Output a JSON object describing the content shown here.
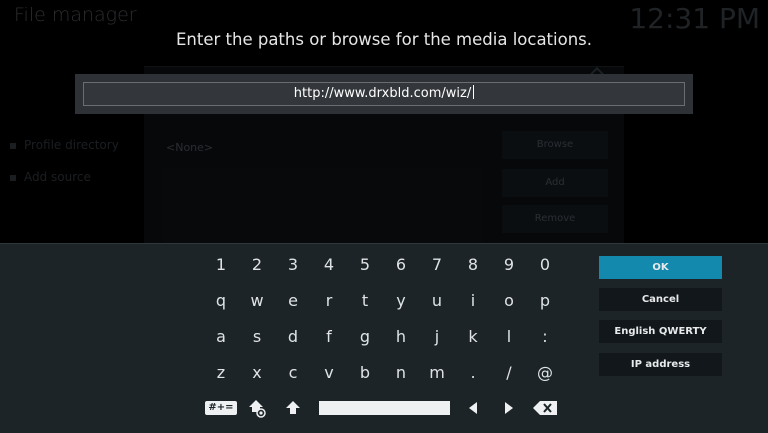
{
  "background": {
    "window_title": "File manager",
    "clock": "12:31 PM",
    "sidebar_items": [
      "Profile directory",
      "Add source"
    ],
    "dialog_none": "<None>",
    "dialog_buttons": [
      "Browse",
      "Add",
      "Remove"
    ]
  },
  "dialog": {
    "heading": "Enter the paths or browse for the media locations.",
    "input_value": "http://www.drxbld.com/wiz/"
  },
  "keyboard": {
    "rows": [
      [
        "1",
        "2",
        "3",
        "4",
        "5",
        "6",
        "7",
        "8",
        "9",
        "0"
      ],
      [
        "q",
        "w",
        "e",
        "r",
        "t",
        "y",
        "u",
        "i",
        "o",
        "p"
      ],
      [
        "a",
        "s",
        "d",
        "f",
        "g",
        "h",
        "j",
        "k",
        "l",
        ":"
      ],
      [
        "z",
        "x",
        "c",
        "v",
        "b",
        "n",
        "m",
        ".",
        "/",
        "@"
      ]
    ],
    "symbols_label": "#+=",
    "icons": [
      "symbols-icon",
      "caps-lock-icon",
      "shift-icon",
      "space-bar",
      "cursor-left-icon",
      "cursor-right-icon",
      "backspace-icon"
    ]
  },
  "actions": {
    "ok": "OK",
    "cancel": "Cancel",
    "layout": "English QWERTY",
    "ip": "IP address"
  },
  "colors": {
    "accent": "#1289ad",
    "panel": "#1c2428"
  }
}
